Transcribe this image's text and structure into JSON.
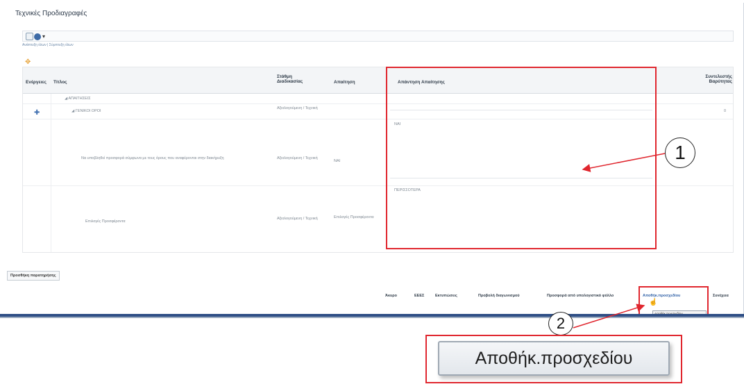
{
  "page": {
    "title": "Τεχνικές Προδιαγραφές",
    "links": "Ανάπτυξη όλων | Σύμπτυξη όλων"
  },
  "table": {
    "headers": {
      "action": "Ενέργειες",
      "title": "Τίτλος",
      "level": "Στάθμη Διαδικασίας",
      "requirement": "Απαίτηση",
      "response": "Απάντηση Απαίτησης",
      "weight": "Συντελεστής Βαρύτητας"
    },
    "rows": [
      {
        "title": "ΑΠΑΙΤΗΣΕΙΣ",
        "level": "",
        "requirement": "",
        "response": ""
      },
      {
        "title": "ΓΕΝΙΚΟΙ ΟΡΟΙ",
        "level": "Αξιολογούμενη / Τεχνική",
        "requirement": "",
        "response": ""
      },
      {
        "title": "Να υποβληθεί προσφορά σύμφωνα με τους όρους που αναφέρονται στην διακήρυξη",
        "level": "Αξιολογούμενη / Τεχνική",
        "requirement": "ΝΑΙ",
        "response": "ΝΑΙ"
      },
      {
        "title": "Επιλογές Προσφέροντα",
        "level": "Αξιολογούμενη / Τεχνική",
        "requirement": "Επιλογές Προσφέροντα",
        "response": "ΠΕΡΙΣΣΟΤΕΡΑ"
      }
    ]
  },
  "buttons": {
    "add_comment": "Προσθήκη παρατηρήσης",
    "bottom": [
      "Άκυρο",
      "ΕΕΕΣ",
      "Εκτυπώσεις",
      "Προβολή διαγωνισμού",
      "Προσφορά από υπολογιστικό φύλλο",
      "Αποθήκ.προσχεδίου",
      "Συνέχεια"
    ],
    "tooltip": "Αποθήκ.προσχεδίου",
    "zoomed": "Αποθήκ.προσχεδίου"
  },
  "callouts": {
    "one": "1",
    "two": "2"
  },
  "colors": {
    "highlight": "#e0262e",
    "accent": "#3363a8"
  }
}
